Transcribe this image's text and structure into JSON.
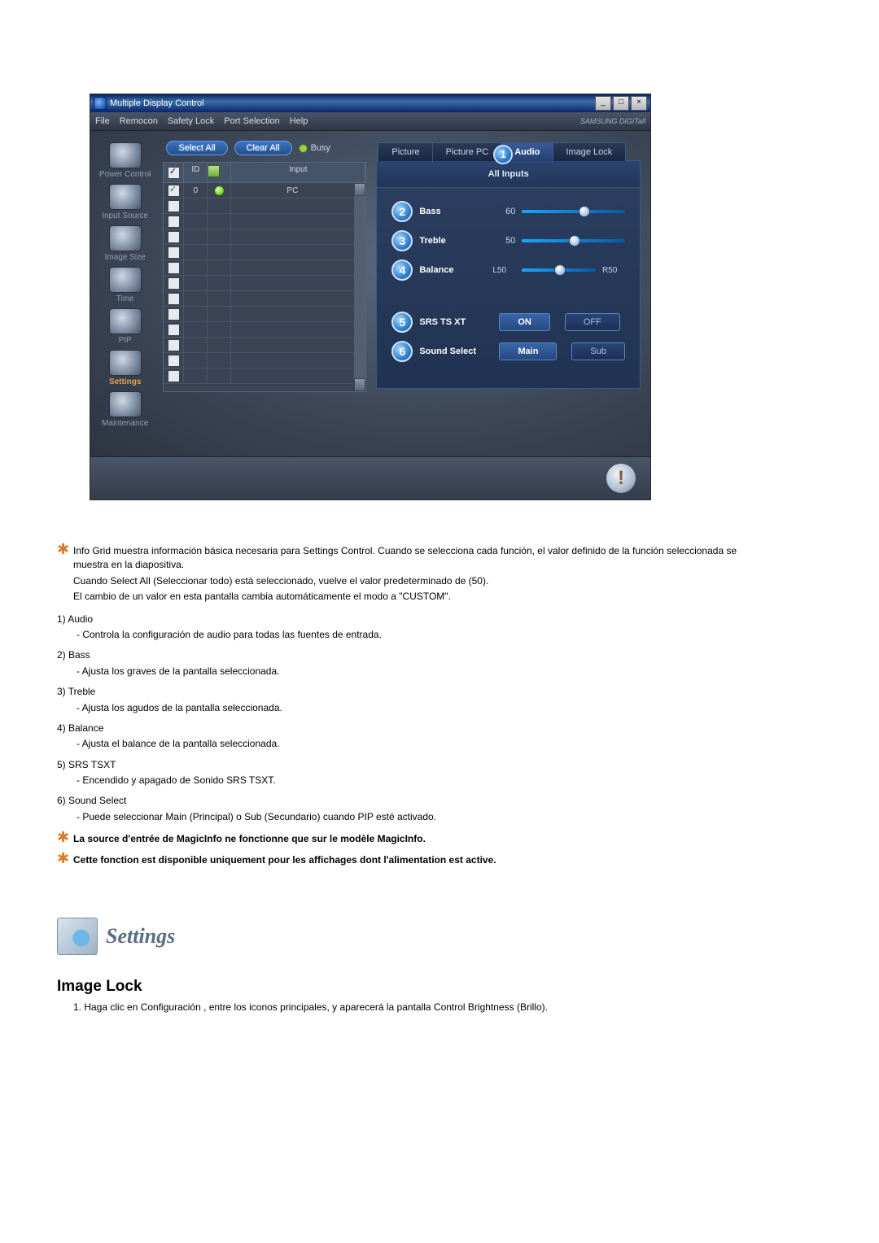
{
  "window": {
    "title": "Multiple Display Control",
    "menubar": [
      "File",
      "Remocon",
      "Safety Lock",
      "Port Selection",
      "Help"
    ],
    "brand": "SAMSUNG DIGITall",
    "buttons": {
      "select_all": "Select All",
      "clear_all": "Clear All",
      "busy": "Busy"
    },
    "grid": {
      "headers": {
        "check": "☑",
        "id": "ID",
        "lamp": " ",
        "input": "Input"
      },
      "row0": {
        "id": "0",
        "input": "PC"
      }
    },
    "sidebar": [
      {
        "label": "Power Control"
      },
      {
        "label": "Input Source"
      },
      {
        "label": "Image Size"
      },
      {
        "label": "Time"
      },
      {
        "label": "PIP"
      },
      {
        "label": "Settings",
        "active": true
      },
      {
        "label": "Maintenance"
      }
    ],
    "tabs": {
      "picture": "Picture",
      "picture_pc": "Picture PC",
      "audio": "Audio",
      "image_lock": "Image Lock"
    },
    "panel": {
      "all_inputs": "All Inputs",
      "bass": {
        "label": "Bass",
        "value": "60"
      },
      "treble": {
        "label": "Treble",
        "value": "50"
      },
      "balance": {
        "label": "Balance",
        "left": "L50",
        "right": "R50"
      },
      "srs": {
        "label": "SRS TS XT",
        "on": "ON",
        "off": "OFF"
      },
      "sound": {
        "label": "Sound Select",
        "main": "Main",
        "sub": "Sub"
      }
    }
  },
  "doc": {
    "star1a": "Info Grid muestra información básica necesaria para Settings Control. Cuando se selecciona cada función, el valor definido de la función seleccionada se muestra en la diapositiva.",
    "star1b": "Cuando Select All (Seleccionar todo) está seleccionado, vuelve el valor predeterminado de (50).",
    "star1c": "El cambio de un valor en esta pantalla cambia automáticamente el modo a \"CUSTOM\".",
    "i1t": "1)  Audio",
    "i1s": "- Controla la configuración de audio para todas las fuentes de entrada.",
    "i2t": "2)  Bass",
    "i2s": "- Ajusta los graves de la pantalla seleccionada.",
    "i3t": "3)  Treble",
    "i3s": "- Ajusta los agudos de la pantalla seleccionada.",
    "i4t": "4)  Balance",
    "i4s": "- Ajusta el balance de la pantalla seleccionada.",
    "i5t": "5)  SRS TSXT",
    "i5s": "- Encendido y apagado de Sonido SRS TSXT.",
    "i6t": "6)  Sound Select",
    "i6s": "- Puede seleccionar Main (Principal) o Sub (Secundario) cuando PIP esté activado.",
    "note1": "La source d'entrée de MagicInfo ne fonctionne que sur le modèle MagicInfo.",
    "note2": "Cette fonction est disponible uniquement pour les affichages dont l'alimentation est active.",
    "settings_title": "Settings",
    "h3": "Image Lock",
    "step1": "1.  Haga clic en Configuración , entre los iconos principales, y aparecerá la pantalla Control Brightness (Brillo)."
  }
}
